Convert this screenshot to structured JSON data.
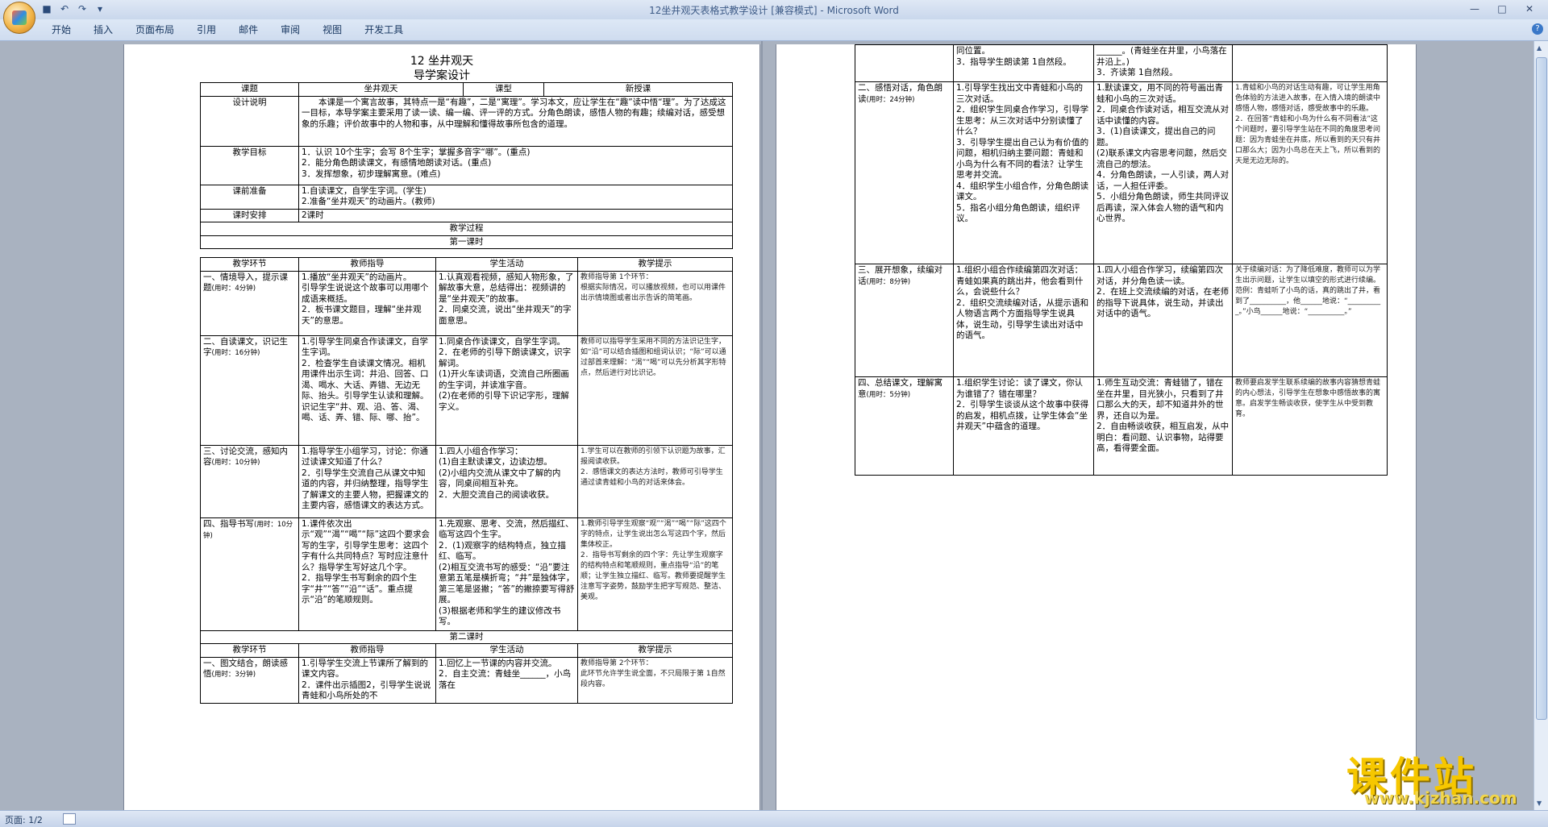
{
  "window": {
    "title": "12坐井观天表格式教学设计 [兼容模式] - Microsoft Word",
    "controls": [
      "minimize",
      "maximize",
      "close"
    ]
  },
  "menu": {
    "tabs": [
      "开始",
      "插入",
      "页面布局",
      "引用",
      "邮件",
      "审阅",
      "视图",
      "开发工具"
    ]
  },
  "status": {
    "page": "页面: 1/2"
  },
  "watermark": {
    "text": "课件站",
    "url": "www.kjzhan.com"
  },
  "doc": {
    "title": "12   坐井观天",
    "subtitle": "导学案设计",
    "header_row": {
      "topic_label": "课题",
      "topic_value": "坐井观天",
      "type_label": "课型",
      "type_value": "新授课"
    },
    "design_label": "设计说明",
    "design_text": "本课是一个寓言故事，其特点一是“有趣”，二是“寓理”。学习本文，应让学生在“趣”读中悟“理”。为了达成这一目标，本导学案主要采用了读一读、编一编、评一评的方式。分角色朗读，感悟人物的有趣；续编对话，感受想象的乐趣；评价故事中的人物和事，从中理解和懂得故事所包含的道理。",
    "goals_label": "教学目标",
    "goals": [
      "1．认识 10个生字；会写 8个生字；掌握多音字“哪”。(重点)",
      "2．能分角色朗读课文，有感情地朗读对话。(重点)",
      "3．发挥想象，初步理解寓意。(难点)"
    ],
    "prep_label": "课前准备",
    "prep": [
      "1.自读课文，自学生字词。(学生)",
      "2.准备“坐井观天”的动画片。(教师)"
    ],
    "hours_label": "课时安排",
    "hours_value": "2课时",
    "process_label": "教学过程",
    "lesson1_label": "第一课时",
    "lesson2_label": "第二课时",
    "col_headers": [
      "教学环节",
      "教师指导",
      "学生活动",
      "教学提示"
    ],
    "lesson1_rows": [
      {
        "stage": "一、情境导入，提示课题",
        "time": "(用时：4分钟)",
        "teacher": "1.播放“坐井观天”的动画片。\n引导学生说说这个故事可以用哪个成语来概括。\n2．板书课文题目，理解“坐井观天”的意思。",
        "student": "1.认真观看视频，感知人物形象，了解故事大意，总结得出：视频讲的是“坐井观天”的故事。\n2．同桌交流，说出“坐井观天”的字面意思。",
        "tip": "教师指导第 1个环节：\n根据实际情况，可以播放视频，也可以用课件出示情境图或者出示告诉的简笔画。"
      },
      {
        "stage": "二、自读课文，识记生字",
        "time": "(用时：16分钟)",
        "teacher": "1.引导学生同桌合作读课文，自学生字词。\n2．检查学生自读课文情况。相机用课件出示生词：井沿、回答、口渴、喝水、大话、弄错、无边无际、抬头。引导学生认读和理解。\n识记生字“井、观、沿、答、渴、喝、话、弄、错、际、哪、抬”。",
        "student": "1.同桌合作读课文，自学生字词。\n2．在老师的引导下朗读课文，识字解词。\n(1)开火车读词语，交流自己所圈画的生字词，并读准字音。\n(2)在老师的引导下识记字形，理解字义。",
        "tip": "教师可以指导学生采用不同的方法识记生字，如“沿”可以结合插图和组词认识；“际”可以通过部首来理解：“渴”“喝”可以先分析其字形特点，然后进行对比识记。"
      },
      {
        "stage": "三、讨论交流，感知内容",
        "time": "(用时：10分钟)",
        "teacher": "1.指导学生小组学习，讨论：你通过读课文知道了什么？\n2．引导学生交流自己从课文中知道的内容，并归纳整理，指导学生了解课文的主要人物，把握课文的主要内容，感悟课文的表达方式。",
        "student": "1.四人小组合作学习：\n(1)自主默读课文，边读边想。\n(2)小组内交流从课文中了解的内容，同桌间相互补充。\n2．大胆交流自己的阅读收获。",
        "tip": "1.学生可以在教师的引领下认识题为故事，汇报阅读收获。\n2．感悟课文的表达方法时，教师可引导学生通过读青蛙和小鸟的对话来体会。"
      },
      {
        "stage": "四、指导书写",
        "time": "(用时：10分钟)",
        "teacher": "1.课件依次出示“观”“渴”“喝”“际”这四个要求会写的生字，引导学生思考：这四个字有什么共同特点？写时应注意什么？指导学生写好这几个字。\n2．指导学生书写剩余的四个生字“井”“答”“沿”“话”。重点提示“沿”的笔顺规则。",
        "student": "1.先观察、思考、交流，然后描红、临写这四个生字。\n2．(1)观察字的结构特点，独立描红、临写。\n(2)相互交流书写的感受：“沿”要注意第五笔是横折弯；“井”是独体字，第三笔是竖撇；“答”的撇捺要写得舒展。\n(3)根据老师和学生的建议修改书写。",
        "tip": "1.教师引导学生观察“观”“渴”“喝”“际”这四个字的特点，让学生说出怎么写这四个字，然后集体校正。\n2．指导书写剩余的四个字：先让学生观察字的结构特点和笔顺规则，重点指导“沿”的笔顺；让学生独立描红、临写。教师要提醒学生注意写字姿势，鼓励学生把字写规范、整洁、美观。"
      }
    ],
    "lesson2_first_row": {
      "stage": "一、图文结合，朗读感悟",
      "time": "(用时：3分钟)",
      "teacher": "1.引导学生交流上节课所了解到的课文内容。\n2．课件出示插图2，引导学生说说青蛙和小鸟所处的不",
      "student": "1.回忆上一节课的内容并交流。\n2．自主交流：青蛙坐______，小鸟落在",
      "tip": "教师指导第 2个环节：\n此环节允许学生说全面，不只局限于第 1自然段内容。"
    },
    "page2_rows": [
      {
        "stage": "",
        "time": "",
        "teacher": "同位置。\n3．指导学生朗读第 1自然段。",
        "student": "______。(青蛙坐在井里，小鸟落在井沿上。)\n3．齐读第 1自然段。",
        "tip": ""
      },
      {
        "stage": "二、感悟对话，角色朗读",
        "time": "(用时：24分钟)",
        "teacher": "1.引导学生找出文中青蛙和小鸟的三次对话。\n2．组织学生同桌合作学习，引导学生思考：从三次对话中分别读懂了什么？\n3．引导学生提出自己认为有价值的问题，相机归纳主要问题：青蛙和小鸟为什么有不同的看法？让学生思考并交流。\n4．组织学生小组合作，分角色朗读课文。\n5．指名小组分角色朗读，组织评议。",
        "student": "1.默读课文，用不同的符号画出青蛙和小鸟的三次对话。\n2．同桌合作读对话，相互交流从对话中读懂的内容。\n3．(1)自读课文，提出自己的问题。\n(2)联系课文内容思考问题，然后交流自己的想法。\n4．分角色朗读，一人引读，两人对话，一人担任评委。\n5．小组分角色朗读，师生共同评议后再读，深入体会人物的语气和内心世界。",
        "tip": "1.青蛙和小鸟的对话生动有趣，可让学生用角色体验的方法进入故事，在入情入境的朗读中感悟人物，感悟对话，感受故事中的乐趣。\n2．在回答“青蛙和小鸟为什么有不同看法”这个问题时，要引导学生站在不同的角度思考问题：因为青蛙坐在井底，所以看到的天只有井口那么大；因为小鸟总在天上飞，所以看到的天是无边无际的。"
      },
      {
        "stage": "三、展开想象，续编对话",
        "time": "(用时：8分钟)",
        "teacher": "1.组织小组合作续编第四次对话：青蛙如果真的跳出井，他会看到什么，会说些什么？\n2．组织交流续编对话，从提示语和人物语言两个方面指导学生说具体，说生动，引导学生读出对话中的语气。",
        "student": "1.四人小组合作学习，续编第四次对话，并分角色读一读。\n2．在班上交流续编的对话，在老师的指导下说具体，说生动，并读出对话中的语气。",
        "tip": "关于续编对话：为了降低难度，教师可以为学生出示问题，让学生以填空的形式进行续编。范例：青蛙听了小鸟的话，真的跳出了井，看到了__________，他______地说：“__________。”小鸟______地说：“__________。”"
      },
      {
        "stage": "四、总结课文，理解寓意",
        "time": "(用时：5分钟)",
        "teacher": "1.组织学生讨论：读了课文，你认为谁错了？错在哪里？\n2．引导学生谈谈从这个故事中获得的启发，相机点拨，让学生体会“坐井观天”中蕴含的道理。",
        "student": "1.师生互动交流：青蛙错了，错在坐在井里，目光狭小，只看到了井口那么大的天，却不知道井外的世界，还自以为是。\n2．自由畅谈收获，相互启发，从中明白：看问题、认识事物，站得要高，看得要全面。",
        "tip": "教师要启发学生联系续编的故事内容猜想青蛙的内心想法，引导学生在想象中感悟故事的寓意。启发学生畅谈收获，使学生从中受到教育。"
      }
    ]
  }
}
